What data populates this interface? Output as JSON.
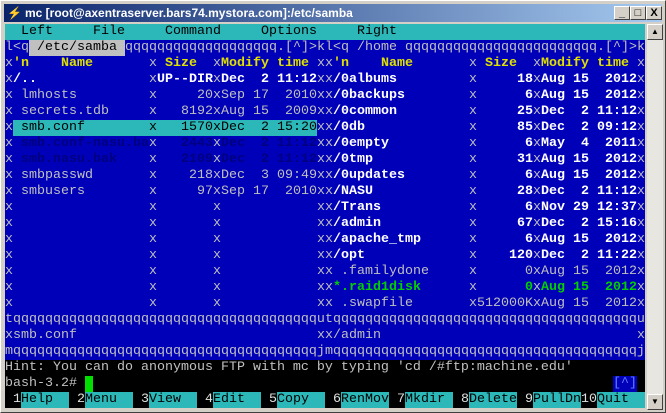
{
  "window": {
    "title": "mc [root@axentraserver.bars74.mystora.com]:/etc/samba",
    "minimize": "_",
    "maximize": "□",
    "close": "X"
  },
  "menu": [
    "Left",
    "File",
    "Command",
    "Options",
    "Right"
  ],
  "left_panel": {
    "path": "/etc/samba",
    "path_suffix": ".[^]>k",
    "headers": {
      "sort": "'n",
      "name": "Name",
      "size": "Size",
      "date": "Modify time"
    },
    "files": [
      {
        "type": "/",
        "name": "..",
        "size": "UP--DIR",
        "date": "Dec  2 11:12",
        "style": "dir"
      },
      {
        "type": " ",
        "name": "lmhosts",
        "size": "20",
        "date": "Sep 17  2010",
        "style": "normal"
      },
      {
        "type": " ",
        "name": "secrets.tdb",
        "size": "8192",
        "date": "Aug 15  2009",
        "style": "normal"
      },
      {
        "type": " ",
        "name": "smb.conf",
        "size": "1570",
        "date": "Dec  2 15:20",
        "style": "selected"
      },
      {
        "type": " ",
        "name": "smb.conf-nasu.bak",
        "size": "2443",
        "date": "Dec  2 11:12",
        "style": "dim"
      },
      {
        "type": " ",
        "name": "smb.nasu.bak",
        "size": "2109",
        "date": "Dec  2 11:12",
        "style": "dim"
      },
      {
        "type": " ",
        "name": "smbpasswd",
        "size": "218",
        "date": "Dec  3 09:49",
        "style": "normal"
      },
      {
        "type": " ",
        "name": "smbusers",
        "size": "97",
        "date": "Sep 17  2010",
        "style": "normal"
      }
    ],
    "status": "smb.conf"
  },
  "right_panel": {
    "path": "/home",
    "path_suffix": ".[^]>k",
    "headers": {
      "sort": "'n",
      "name": "Name",
      "size": "Size",
      "date": "Modify time"
    },
    "files": [
      {
        "type": "/",
        "name": "0albums",
        "size": "18",
        "date": "Aug 15  2012",
        "style": "dir"
      },
      {
        "type": "/",
        "name": "0backups",
        "size": "6",
        "date": "Aug 15  2012",
        "style": "dir"
      },
      {
        "type": "/",
        "name": "0common",
        "size": "25",
        "date": "Dec  2 11:12",
        "style": "dir"
      },
      {
        "type": "/",
        "name": "0db",
        "size": "85",
        "date": "Dec  2 09:12",
        "style": "dir"
      },
      {
        "type": "/",
        "name": "0empty",
        "size": "6",
        "date": "May  4  2011",
        "style": "dir"
      },
      {
        "type": "/",
        "name": "0tmp",
        "size": "31",
        "date": "Aug 15  2012",
        "style": "dir"
      },
      {
        "type": "/",
        "name": "0updates",
        "size": "6",
        "date": "Aug 15  2012",
        "style": "dir"
      },
      {
        "type": "/",
        "name": "NASU",
        "size": "28",
        "date": "Dec  2 11:12",
        "style": "dir"
      },
      {
        "type": "/",
        "name": "Trans",
        "size": "6",
        "date": "Nov 29 12:37",
        "style": "dir"
      },
      {
        "type": "/",
        "name": "admin",
        "size": "67",
        "date": "Dec  2 15:16",
        "style": "dir"
      },
      {
        "type": "/",
        "name": "apache_tmp",
        "size": "6",
        "date": "Aug 15  2012",
        "style": "dir"
      },
      {
        "type": "/",
        "name": "opt",
        "size": "120",
        "date": "Dec  2 11:22",
        "style": "dir"
      },
      {
        "type": " ",
        "name": ".familydone",
        "size": "0",
        "date": "Aug 15  2012",
        "style": "normal"
      },
      {
        "type": "*",
        "name": ".raid1disk",
        "size": "0",
        "date": "Aug 15  2012",
        "style": "exe"
      },
      {
        "type": " ",
        "name": ".swapfile",
        "size": "512000K",
        "date": "Aug 15  2012",
        "style": "normal"
      }
    ],
    "status": "/admin"
  },
  "hint": "Hint: You can do anonymous FTP with mc by typing 'cd /#ftp:machine.edu'",
  "prompt": "bash-3.2#",
  "subshell_indicator": "[^]",
  "fkeys": [
    {
      "num": "1",
      "label": "Help"
    },
    {
      "num": "2",
      "label": "Menu"
    },
    {
      "num": "3",
      "label": "View"
    },
    {
      "num": "4",
      "label": "Edit"
    },
    {
      "num": "5",
      "label": "Copy"
    },
    {
      "num": "6",
      "label": "RenMov"
    },
    {
      "num": "7",
      "label": "Mkdir"
    },
    {
      "num": "8",
      "label": "Delete"
    },
    {
      "num": "9",
      "label": "PullDn"
    },
    {
      "num": "10",
      "label": "Quit"
    }
  ],
  "colors": {
    "panel_bg": "#0000b8",
    "cyan": "#2cb8b8",
    "header_yellow": "#e0e000",
    "exec_green": "#00d000"
  }
}
